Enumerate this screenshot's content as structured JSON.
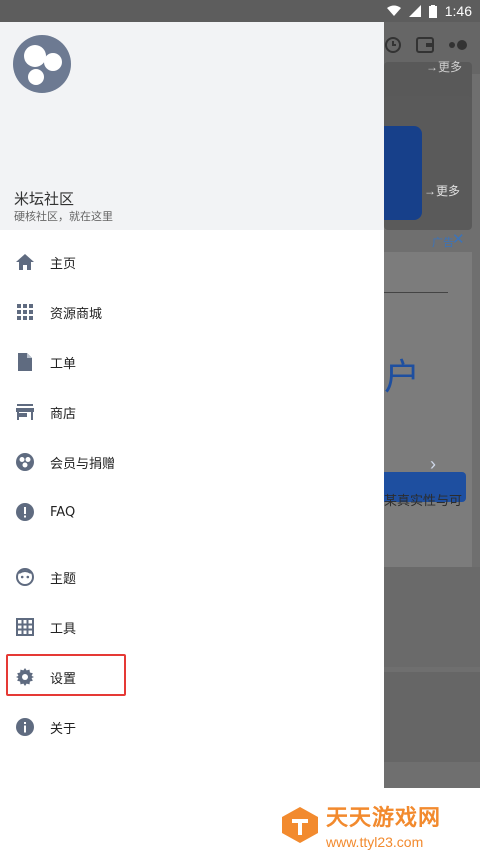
{
  "status": {
    "time": "1:46"
  },
  "background": {
    "more_label_1": "→更多",
    "more_label_2": "→更多",
    "ad_label": "广告",
    "ad_close": "✕",
    "ad_big_text": "户",
    "ad_chevron": "›",
    "ad_text": "某真实性与可"
  },
  "drawer": {
    "title": "米坛社区",
    "tagline": "硬核社区，就在这里",
    "items": [
      {
        "label": "主页",
        "icon": "home-icon"
      },
      {
        "label": "资源商城",
        "icon": "apps-grid-icon"
      },
      {
        "label": "工单",
        "icon": "document-icon"
      },
      {
        "label": "商店",
        "icon": "store-icon"
      },
      {
        "label": "会员与捐赠",
        "icon": "member-icon"
      },
      {
        "label": "FAQ",
        "icon": "info-alert-icon"
      },
      {
        "label": "主题",
        "icon": "face-icon"
      },
      {
        "label": "工具",
        "icon": "grid-table-icon"
      },
      {
        "label": "设置",
        "icon": "gear-icon"
      },
      {
        "label": "关于",
        "icon": "info-icon"
      }
    ],
    "highlighted_item": "设置"
  },
  "watermark": {
    "title": "天天游戏网",
    "url": "www.ttyl23.com"
  },
  "colors": {
    "icon": "#5f6b80",
    "highlight": "#e53935",
    "watermark": "#f28a2e"
  }
}
